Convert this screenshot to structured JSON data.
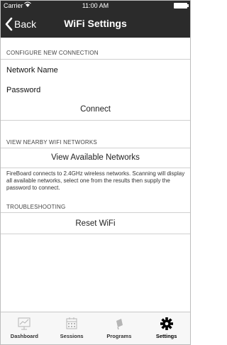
{
  "status_bar": {
    "carrier": "Carrier",
    "time": "11:00 AM"
  },
  "nav": {
    "back_label": "Back",
    "title": "WiFi Settings"
  },
  "configure": {
    "header": "CONFIGURE NEW CONNECTION",
    "network_name_placeholder": "Network Name",
    "password_placeholder": "Password",
    "connect_label": "Connect"
  },
  "nearby": {
    "header": "VIEW NEARBY WIFI NETWORKS",
    "view_label": "View Available Networks",
    "note": "FireBoard connects to 2.4GHz wireless networks. Scanning will display all available networks, select one from the results then supply the password to connect."
  },
  "troubleshooting": {
    "header": "TROUBLESHOOTING",
    "reset_label": "Reset WiFi"
  },
  "tabs": [
    {
      "label": "Dashboard",
      "icon": "dashboard-icon",
      "active": false
    },
    {
      "label": "Sessions",
      "icon": "calendar-icon",
      "active": false
    },
    {
      "label": "Programs",
      "icon": "programs-icon",
      "active": false
    },
    {
      "label": "Settings",
      "icon": "gear-icon",
      "active": true
    }
  ],
  "colors": {
    "bar_background": "#2b2b2b",
    "active_tab": "#000000",
    "inactive_icon": "#b5b5b5"
  }
}
